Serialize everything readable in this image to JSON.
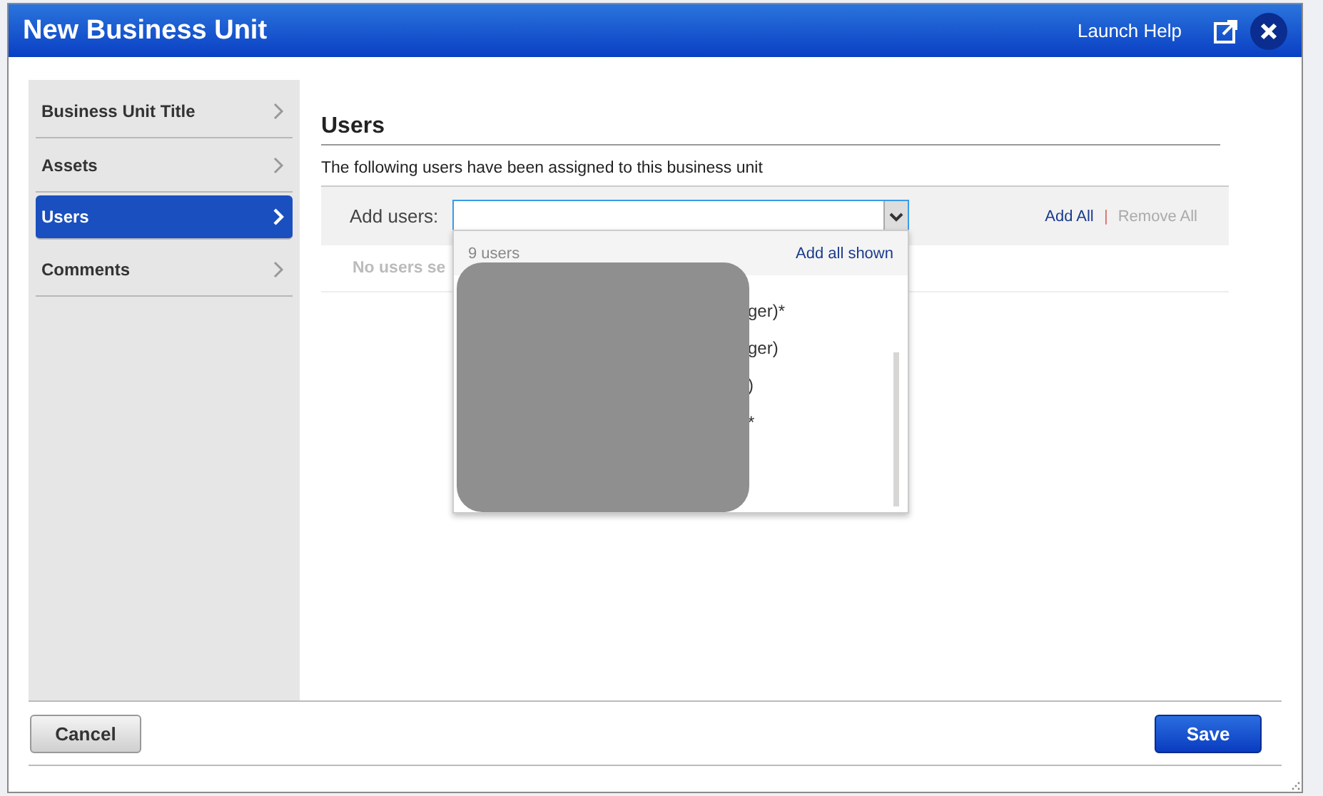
{
  "window": {
    "title": "New Business Unit",
    "help_link": "Launch Help"
  },
  "sidebar": {
    "items": [
      {
        "label": "Business Unit Title",
        "selected": false
      },
      {
        "label": "Assets",
        "selected": false
      },
      {
        "label": "Users",
        "selected": true
      },
      {
        "label": "Comments",
        "selected": false
      }
    ]
  },
  "section": {
    "title": "Users",
    "description": "The following users have been assigned to this business unit"
  },
  "add_users": {
    "label": "Add users:",
    "add_all": "Add All",
    "separator": "|",
    "remove_all": "Remove All",
    "remove_all_disabled": true,
    "empty_message": "No users se"
  },
  "dropdown": {
    "count": "9 users",
    "add_all_shown": "Add all shown",
    "items": [
      {
        "text": "ger)*"
      },
      {
        "text": "ger)"
      },
      {
        "text": ")"
      },
      {
        "text": "*"
      }
    ]
  },
  "buttons": {
    "cancel": "Cancel",
    "save": "Save"
  }
}
